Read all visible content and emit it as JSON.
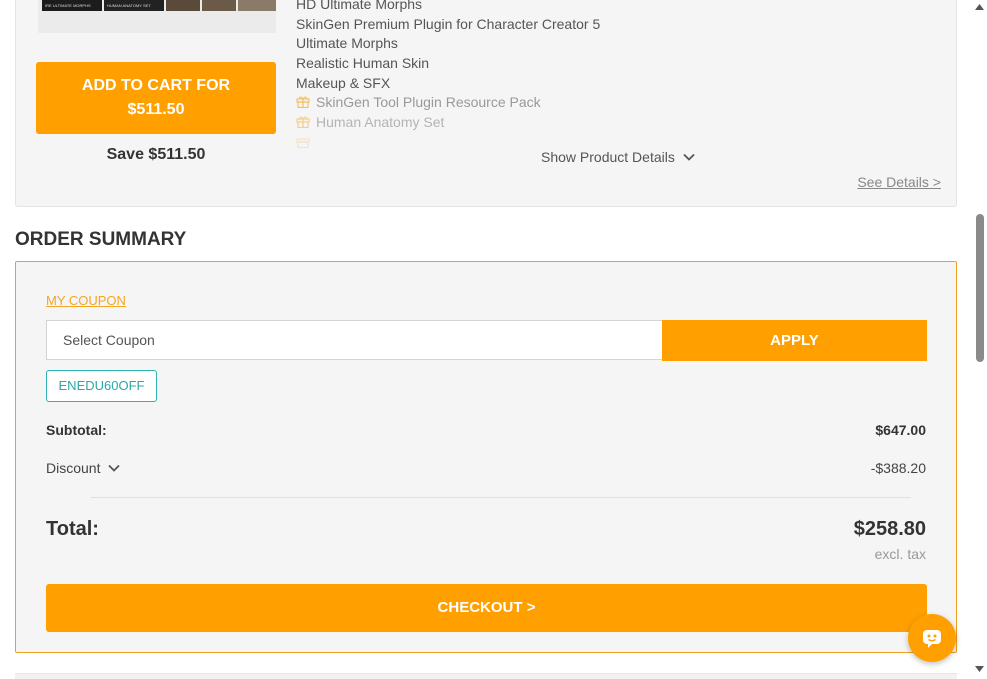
{
  "bundle": {
    "thumb_captions": [
      "IRE ULTIMATE MORPHS",
      "HUMAN ANATOMY SET"
    ],
    "add_to_cart_line1": "ADD TO CART FOR",
    "add_to_cart_line2": "$511.50",
    "save_text": "Save $511.50",
    "items": [
      {
        "label": "HD Ultimate Morphs",
        "gift": false
      },
      {
        "label": "SkinGen Premium Plugin for Character Creator 5",
        "gift": false
      },
      {
        "label": "Ultimate Morphs",
        "gift": false
      },
      {
        "label": "Realistic Human Skin",
        "gift": false
      },
      {
        "label": "Makeup & SFX",
        "gift": false
      },
      {
        "label": "SkinGen Tool Plugin Resource Pack",
        "gift": true
      },
      {
        "label": "Human Anatomy Set",
        "gift": true
      }
    ],
    "show_details_label": "Show Product Details",
    "see_details_label": "See Details >"
  },
  "summary": {
    "heading": "ORDER SUMMARY",
    "my_coupon_label": "MY COUPON",
    "coupon_placeholder": "Select Coupon",
    "apply_label": "APPLY",
    "coupon_code": "ENEDU60OFF",
    "subtotal_label": "Subtotal:",
    "subtotal_value": "$647.00",
    "discount_label": "Discount",
    "discount_value": "-$388.20",
    "total_label": "Total:",
    "total_value": "$258.80",
    "tax_note": "excl. tax",
    "checkout_label": "CHECKOUT >"
  },
  "colors": {
    "accent": "#ffa000",
    "coupon_chip": "#2cb3b3",
    "link_orange": "#f5a623"
  },
  "icons": [
    "gift-icon",
    "chevron-down-icon",
    "chat-icon",
    "scroll-up-icon",
    "scroll-down-icon"
  ]
}
